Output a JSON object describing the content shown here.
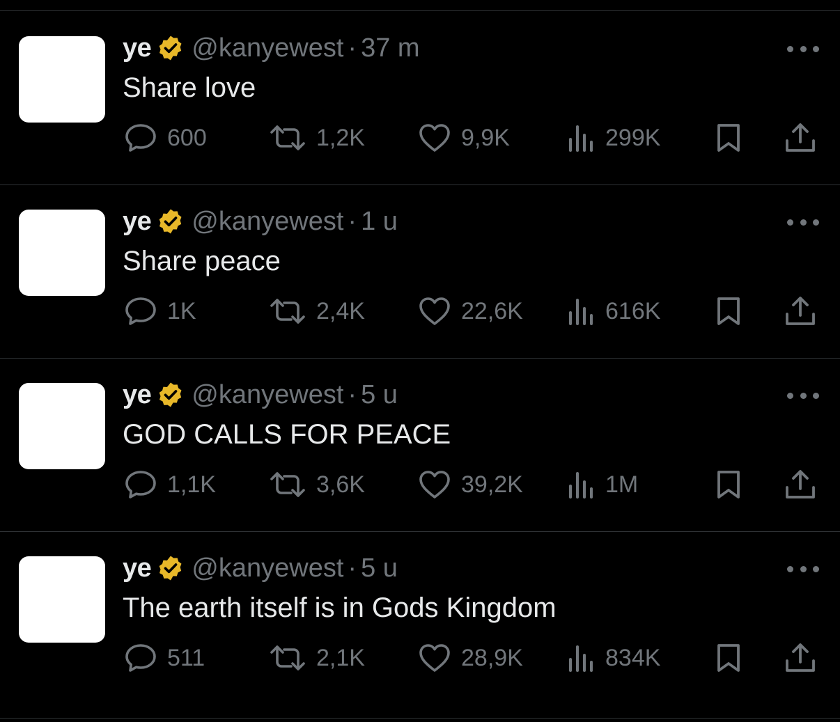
{
  "colors": {
    "background": "#000000",
    "primary_text": "#e7e9ea",
    "secondary_text": "#71767b",
    "divider": "#2f3336",
    "verified_badge": "#e8b829"
  },
  "tweets": [
    {
      "name": "ye",
      "handle": "@kanyewest",
      "separator": "·",
      "time": "37 m",
      "text": "Share love",
      "replies": "600",
      "reposts": "1,2K",
      "likes": "9,9K",
      "views": "299K"
    },
    {
      "name": "ye",
      "handle": "@kanyewest",
      "separator": "·",
      "time": "1 u",
      "text": "Share peace",
      "replies": "1K",
      "reposts": "2,4K",
      "likes": "22,6K",
      "views": "616K"
    },
    {
      "name": "ye",
      "handle": "@kanyewest",
      "separator": "·",
      "time": "5 u",
      "text": "GOD CALLS FOR PEACE",
      "replies": "1,1K",
      "reposts": "3,6K",
      "likes": "39,2K",
      "views": "1M"
    },
    {
      "name": "ye",
      "handle": "@kanyewest",
      "separator": "·",
      "time": "5 u",
      "text": "The earth itself is in Gods Kingdom",
      "replies": "511",
      "reposts": "2,1K",
      "likes": "28,9K",
      "views": "834K"
    }
  ],
  "icons": {
    "verified": "verified-badge-icon",
    "more": "more-options-icon",
    "reply": "reply-icon",
    "repost": "repost-icon",
    "like": "heart-icon",
    "views": "views-icon",
    "bookmark": "bookmark-icon",
    "share": "share-icon"
  }
}
